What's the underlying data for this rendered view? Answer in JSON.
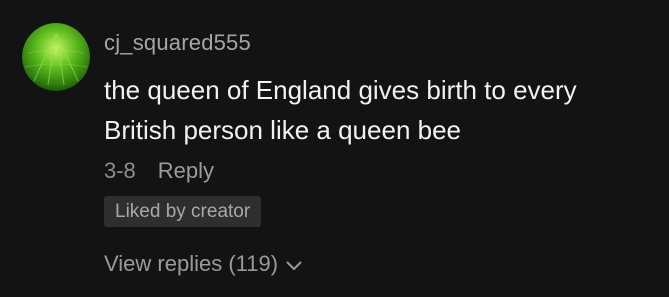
{
  "comment": {
    "avatar_icon": "green-sphere-avatar",
    "username": "cj_squared555",
    "text": "the queen of England gives birth to every British person like a queen bee",
    "date": "3-8",
    "reply_label": "Reply",
    "liked_badge": "Liked by creator",
    "view_replies_label": "View replies (119)",
    "view_replies_icon": "chevron-down-icon"
  },
  "colors": {
    "background": "#131313",
    "username": "#a6a6a6",
    "text": "#f1f1f1",
    "muted": "#8d8d8d",
    "badge_bg": "#2e2e2e",
    "avatar_green": "#4fb51c"
  }
}
